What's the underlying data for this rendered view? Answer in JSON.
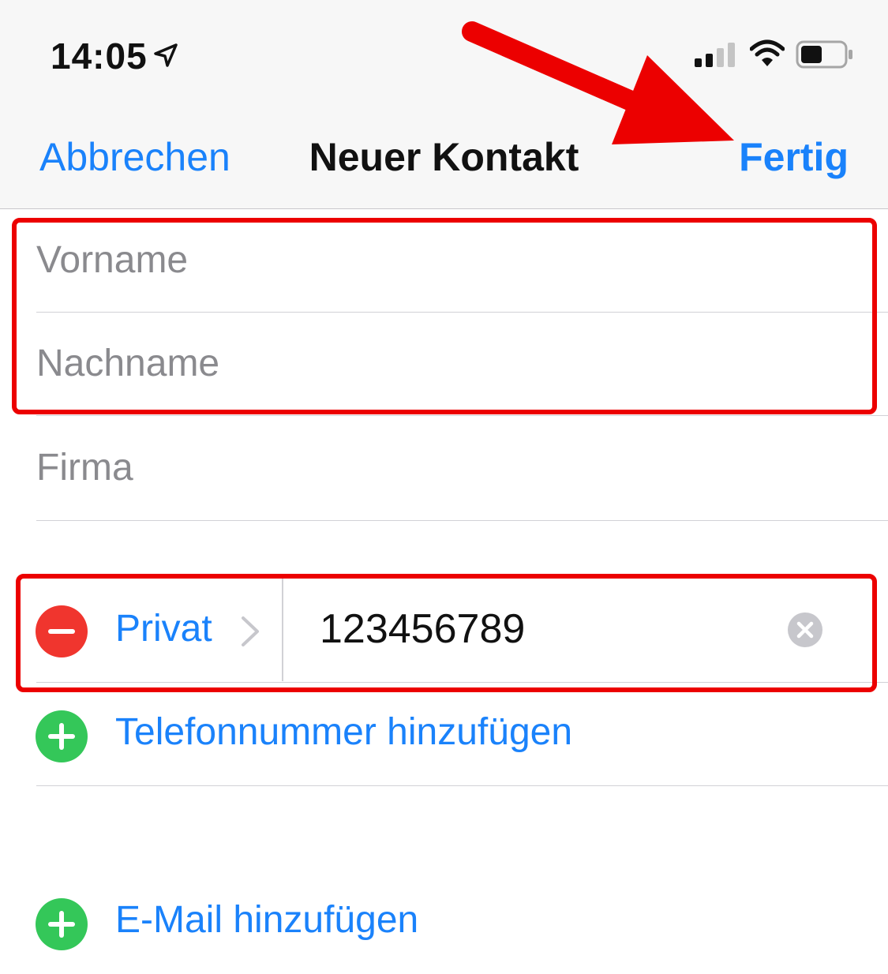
{
  "status_bar": {
    "time": "14:05",
    "icons": [
      "location-arrow-icon",
      "cellular-signal-icon",
      "wifi-icon",
      "battery-icon"
    ]
  },
  "nav": {
    "cancel_label": "Abbrechen",
    "title": "Neuer Kontakt",
    "done_label": "Fertig"
  },
  "fields": {
    "first_name_placeholder": "Vorname",
    "last_name_placeholder": "Nachname",
    "company_placeholder": "Firma"
  },
  "phone": {
    "label": "Privat",
    "value": "123456789"
  },
  "actions": {
    "add_phone_label": "Telefonnummer hinzufügen",
    "add_email_label": "E-Mail hinzufügen"
  },
  "colors": {
    "accent": "#1a82fb",
    "annotation": "#ec0000",
    "delete": "#f0352e",
    "add": "#34c759"
  }
}
